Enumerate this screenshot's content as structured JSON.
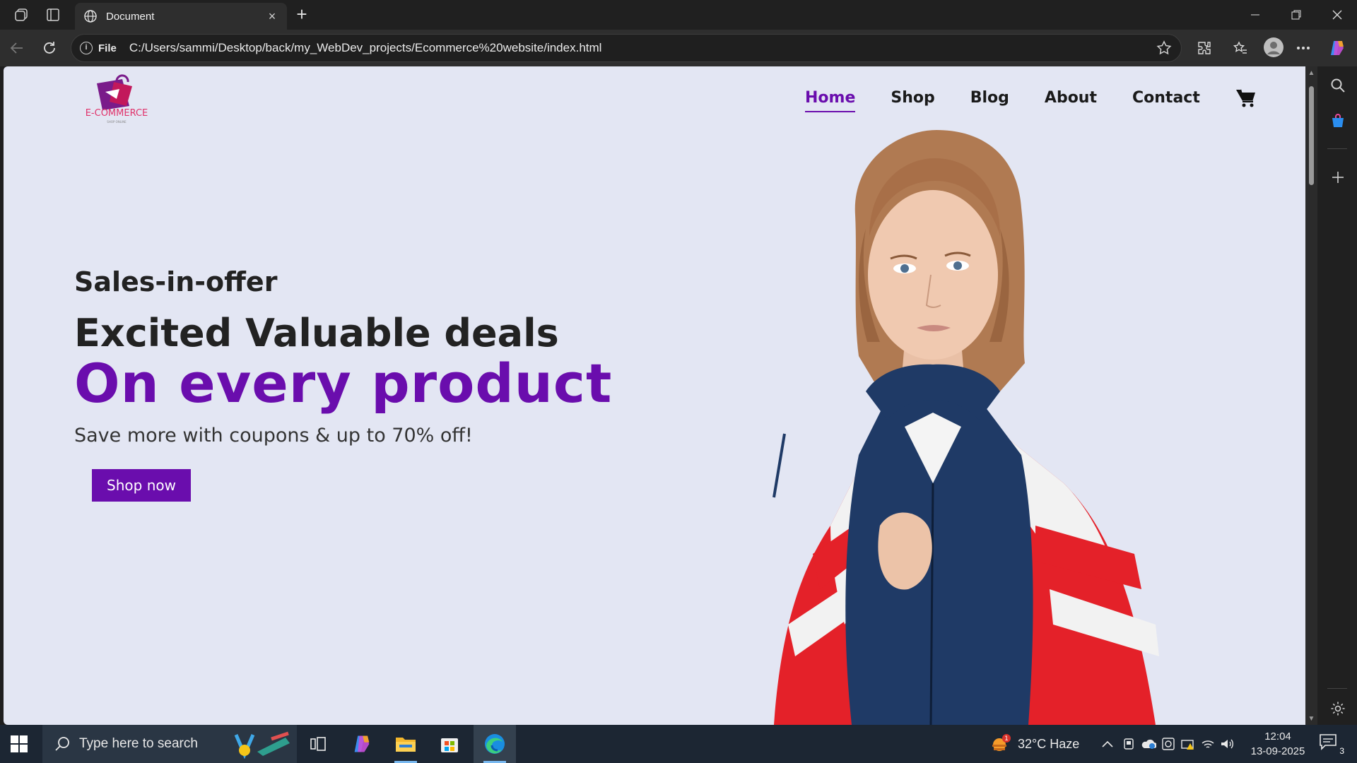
{
  "browser": {
    "tab_title": "Document",
    "url_scheme": "File",
    "url": "C:/Users/sammi/Desktop/back/my_WebDev_projects/Ecommerce%20website/index.html"
  },
  "site": {
    "logo_text": "E-COMMERCE",
    "logo_tagline": "SHOP ONLINE",
    "nav": [
      "Home",
      "Shop",
      "Blog",
      "About",
      "Contact"
    ],
    "active_nav": "Home",
    "accent": "#6a0dad",
    "background": "#e3e6f3"
  },
  "hero": {
    "kicker": "Sales-in-offer",
    "headline": "Excited Valuable deals",
    "highlight": "On every product",
    "subtitle": "Save more with coupons & up to 70% off!",
    "cta": "Shop now"
  },
  "taskbar": {
    "search_placeholder": "Type here to search",
    "weather": "32°C  Haze",
    "weather_badge": "1",
    "time": "12:04",
    "date": "13-09-2025",
    "notifications": "3"
  }
}
